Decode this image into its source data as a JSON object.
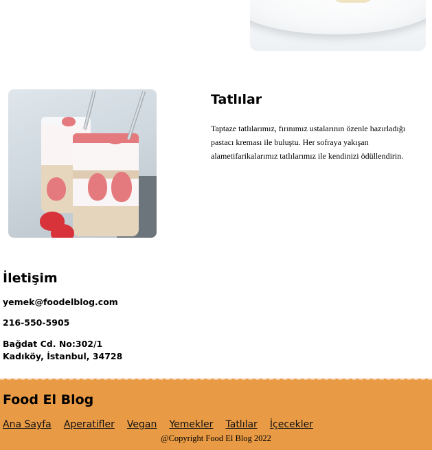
{
  "dessert_section": {
    "title": "Tatlılar",
    "description": "Taptaze tatlılarımız, fırınımız ustalarının özenle hazırladığı pastacı kreması ile buluştu. Her sofraya yakışan alametifarikalarımız tatlılarımız ile kendinizi ödüllendirin."
  },
  "contact": {
    "title": "İletişim",
    "email": "yemek@foodelblog.com",
    "phone": "216-550-5905",
    "address_line1": "Bağdat Cd. No:302/1",
    "address_line2": "Kadıköy, İstanbul, 34728"
  },
  "footer": {
    "title": "Food El Blog",
    "nav": [
      "Ana Sayfa",
      "Aperatifler",
      "Vegan",
      "Yemekler",
      "Tatlılar",
      "İçecekler"
    ],
    "copyright": "@Copyright Food El Blog 2022"
  },
  "colors": {
    "footer_bg": "#e89a45",
    "page_bg": "#ffffff"
  }
}
